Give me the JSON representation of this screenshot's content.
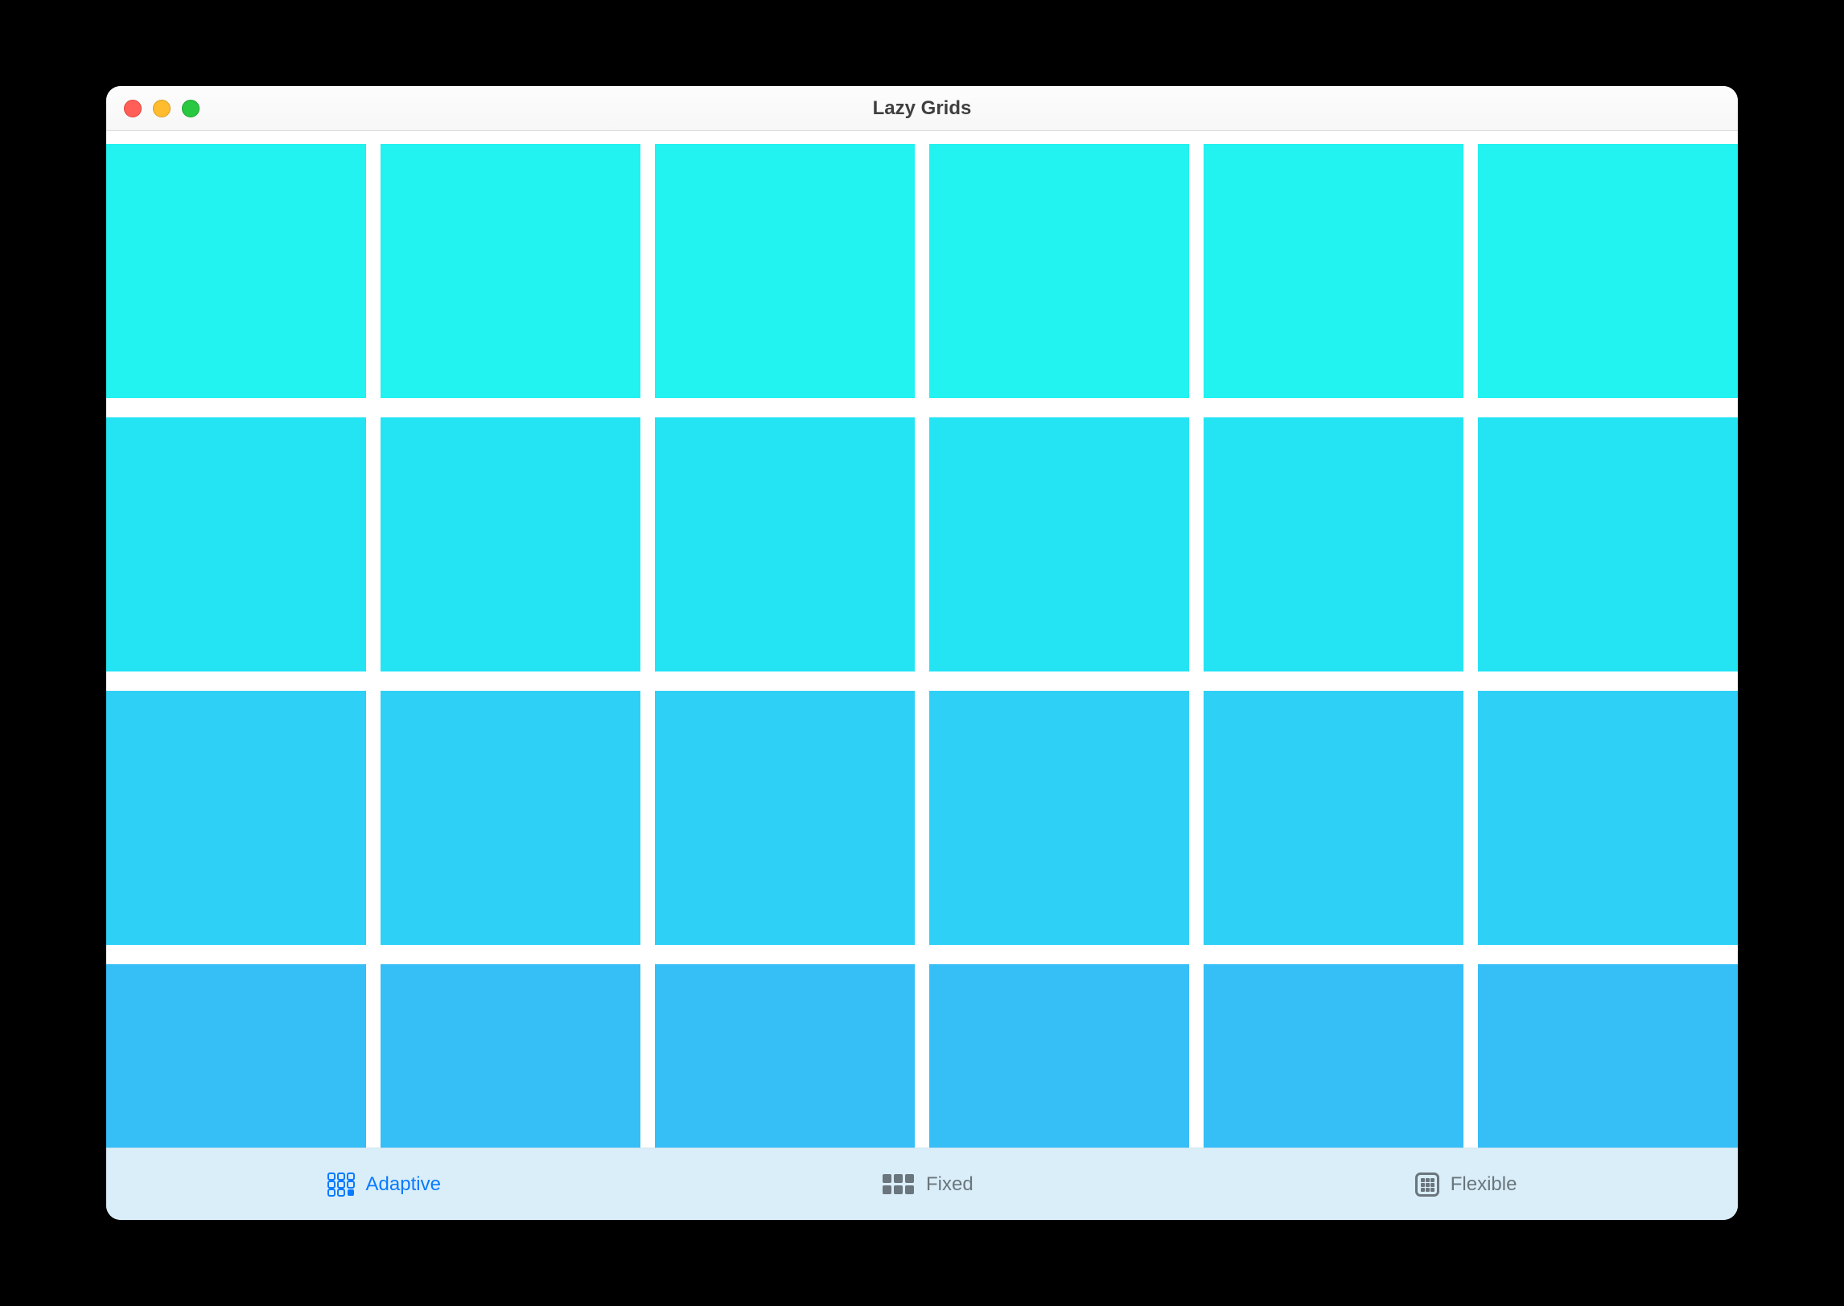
{
  "window": {
    "title": "Lazy Grids"
  },
  "grid": {
    "columns": 6,
    "visible_rows": 4,
    "cells": [
      {
        "color": "#22f2f0"
      },
      {
        "color": "#22f2f0"
      },
      {
        "color": "#22f2f0"
      },
      {
        "color": "#22f2f0"
      },
      {
        "color": "#22f2f0"
      },
      {
        "color": "#22f2f0"
      },
      {
        "color": "#24e4f4"
      },
      {
        "color": "#24e4f4"
      },
      {
        "color": "#24e4f4"
      },
      {
        "color": "#24e4f4"
      },
      {
        "color": "#24e4f4"
      },
      {
        "color": "#24e4f4"
      },
      {
        "color": "#2fd0f6"
      },
      {
        "color": "#2fd0f6"
      },
      {
        "color": "#2fd0f6"
      },
      {
        "color": "#2fd0f6"
      },
      {
        "color": "#2fd0f6"
      },
      {
        "color": "#2fd0f6"
      },
      {
        "color": "#36bef7"
      },
      {
        "color": "#36bef7"
      },
      {
        "color": "#36bef7"
      },
      {
        "color": "#36bef7"
      },
      {
        "color": "#36bef7"
      },
      {
        "color": "#36bef7"
      }
    ]
  },
  "tabs": {
    "items": [
      {
        "id": "adaptive",
        "label": "Adaptive",
        "icon": "grid-adaptive-icon",
        "active": true
      },
      {
        "id": "fixed",
        "label": "Fixed",
        "icon": "grid-fixed-icon",
        "active": false
      },
      {
        "id": "flexible",
        "label": "Flexible",
        "icon": "grid-flexible-icon",
        "active": false
      }
    ]
  }
}
